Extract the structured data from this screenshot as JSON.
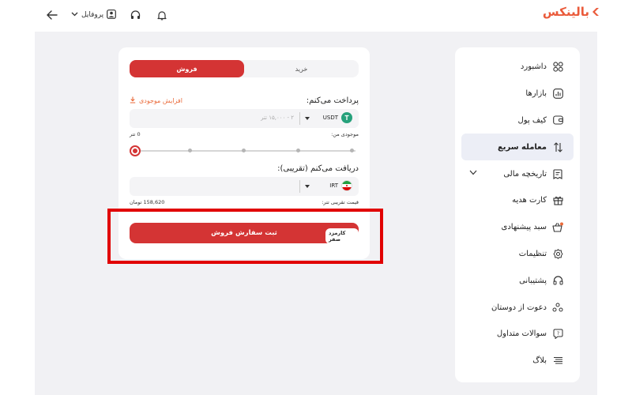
{
  "header": {
    "logo_text": "بالینکس",
    "profile_label": "پروفایل",
    "icons": [
      "back-arrow-icon",
      "chevron-down-icon",
      "user-icon",
      "headphones-icon",
      "bell-icon"
    ]
  },
  "sidebar": {
    "items": [
      {
        "label": "داشبورد",
        "icon": "grid-icon"
      },
      {
        "label": "بازارها",
        "icon": "chart-icon"
      },
      {
        "label": "کیف پول",
        "icon": "wallet-icon"
      },
      {
        "label": "معامله سریع",
        "icon": "swap-arrows-icon",
        "active": true
      },
      {
        "label": "تاریخچه مالی",
        "icon": "history-icon"
      },
      {
        "label": "کارت هدیه",
        "icon": "gift-icon"
      },
      {
        "label": "سبد پیشنهادی",
        "icon": "basket-icon"
      },
      {
        "label": "تنظیمات",
        "icon": "gear-icon"
      },
      {
        "label": "پشتیبانی",
        "icon": "headphones-icon"
      },
      {
        "label": "دعوت از دوستان",
        "icon": "users-icon"
      },
      {
        "label": "سوالات متداول",
        "icon": "question-icon"
      },
      {
        "label": "بلاگ",
        "icon": "menu-lines-icon"
      }
    ]
  },
  "trade": {
    "tab_buy": "خرید",
    "tab_sell": "فروش",
    "pay_label": "پرداخت می‌کنم:",
    "increase_balance": "افزایش موجودی",
    "pay_currency": "USDT",
    "pay_placeholder": "۲ - ۱۵,۰۰۰ تتر",
    "my_balance_label": "موجودی من:",
    "my_balance_value": "0 تتر",
    "slider_level_percent": 0,
    "receive_label": "دریافت می‌کنم (تقریبی):",
    "receive_currency": "IRT",
    "approx_price_label": "قیمت تقریبی تتر:",
    "approx_price_value": "158,620 تومان",
    "submit_label": "ثبت سفارش فروش",
    "fee_badge": "کارمزد صفر"
  },
  "colors": {
    "accent": "#d43434",
    "brand": "#ea5a3a",
    "highlight": "#e10000",
    "usdt": "#26a17b"
  }
}
